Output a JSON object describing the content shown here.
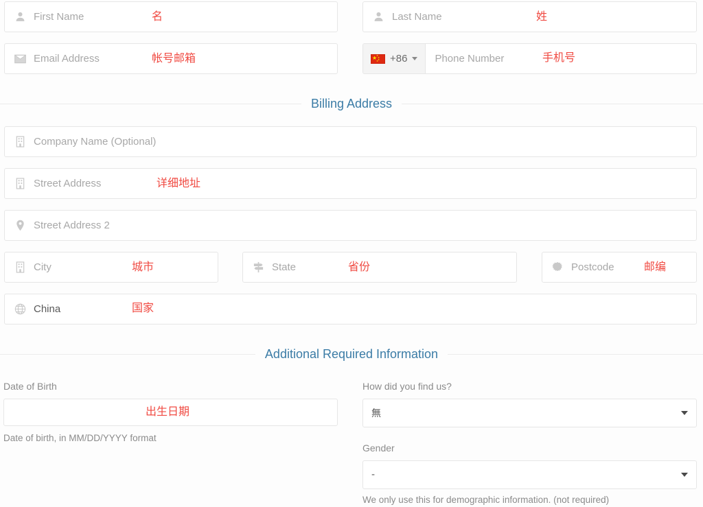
{
  "form": {
    "fields": {
      "first_name": {
        "placeholder": "First Name",
        "icon": "user-icon",
        "annotation": "名"
      },
      "last_name": {
        "placeholder": "Last Name",
        "icon": "user-icon",
        "annotation": "姓"
      },
      "email": {
        "placeholder": "Email Address",
        "icon": "envelope-icon",
        "annotation": "帐号邮箱"
      },
      "phone": {
        "placeholder": "Phone Number",
        "country_code": "+86",
        "country_flag": "china-flag-icon",
        "annotation": "手机号"
      },
      "company": {
        "placeholder": "Company Name (Optional)",
        "icon": "building-icon",
        "annotation": ""
      },
      "street_address": {
        "placeholder": "Street Address",
        "icon": "building-icon",
        "annotation": "详细地址"
      },
      "street_address_2": {
        "placeholder": "Street Address 2",
        "icon": "map-pin-icon",
        "annotation": ""
      },
      "city": {
        "placeholder": "City",
        "icon": "building-icon",
        "annotation": "城市"
      },
      "state": {
        "placeholder": "State",
        "icon": "map-signs-icon",
        "annotation": "省份"
      },
      "postcode": {
        "placeholder": "Postcode",
        "icon": "gear-icon",
        "annotation": "邮编"
      },
      "country": {
        "value": "China",
        "icon": "globe-icon",
        "annotation": "国家"
      },
      "date_of_birth": {
        "label": "Date of Birth",
        "value": "",
        "help": "Date of birth, in MM/DD/YYYY format",
        "annotation": "出生日期"
      },
      "how_find_us": {
        "label": "How did you find us?",
        "selected": "無",
        "help": ""
      },
      "gender": {
        "label": "Gender",
        "selected": "-",
        "help": "We only use this for demographic information. (not required)"
      }
    },
    "sections": [
      {
        "title": "Billing Address"
      },
      {
        "title": "Additional Required Information"
      }
    ]
  },
  "colors": {
    "section_heading": "#3b7ca6",
    "annotation": "#f04a42",
    "placeholder": "#a8a8a8",
    "border": "#e6e6e6",
    "flag_red": "#de2910",
    "flag_yellow": "#ffde00"
  }
}
